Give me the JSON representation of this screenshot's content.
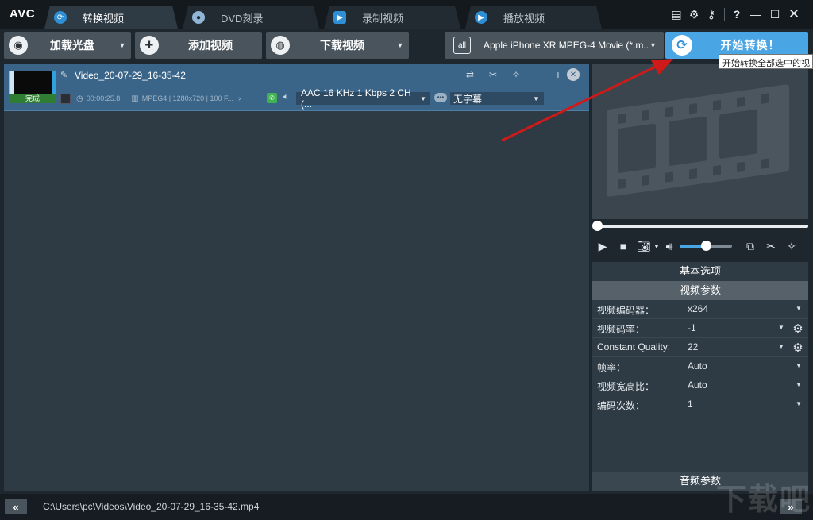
{
  "app": {
    "logo": "AVC"
  },
  "tabs": [
    {
      "label": "转换视频",
      "active": true,
      "icon": "convert-icon"
    },
    {
      "label": "DVD刻录",
      "active": false,
      "icon": "disc-icon"
    },
    {
      "label": "录制视频",
      "active": false,
      "icon": "camera-icon"
    },
    {
      "label": "播放视频",
      "active": false,
      "icon": "play-icon"
    }
  ],
  "window_controls": {
    "help": "?"
  },
  "toolbar": {
    "load_disc": "加载光盘",
    "add_video": "添加视频",
    "download_video": "下载视频",
    "profile_icon_text": "all",
    "profile": "Apple iPhone XR MPEG-4 Movie (*.m...",
    "start_convert": "开始转换！",
    "tooltip": "开始转换全部选中的视"
  },
  "file": {
    "name": "Video_20-07-29_16-35-42",
    "status": "完成",
    "duration": "00:00:25.8",
    "video_info": "MPEG4 | 1280x720 | 100 F...",
    "audio_track": "AAC 16 KHz 1 Kbps 2 CH (...",
    "subtitle": "无字幕"
  },
  "player": {
    "volume_level": 0.5
  },
  "options": {
    "basic_header": "基本选项",
    "video_header": "视频参数",
    "audio_header": "音频参数",
    "rows": [
      {
        "label": "视频编码器：",
        "value": "x264"
      },
      {
        "label": "视频码率：",
        "value": "-1"
      },
      {
        "label": "Constant Quality:",
        "value": "22"
      },
      {
        "label": "帧率：",
        "value": "Auto"
      },
      {
        "label": "视频宽高比：",
        "value": "Auto"
      },
      {
        "label": "编码次数：",
        "value": "1"
      }
    ]
  },
  "status": {
    "back": "«",
    "forward": "»",
    "path": "C:\\Users\\pc\\Videos\\Video_20-07-29_16-35-42.mp4"
  },
  "watermark": "下载吧",
  "colors": {
    "accent": "#4aa5e4",
    "selected_row": "#3a6589",
    "panel": "#2e3a44",
    "arrow": "#d01a1a"
  }
}
